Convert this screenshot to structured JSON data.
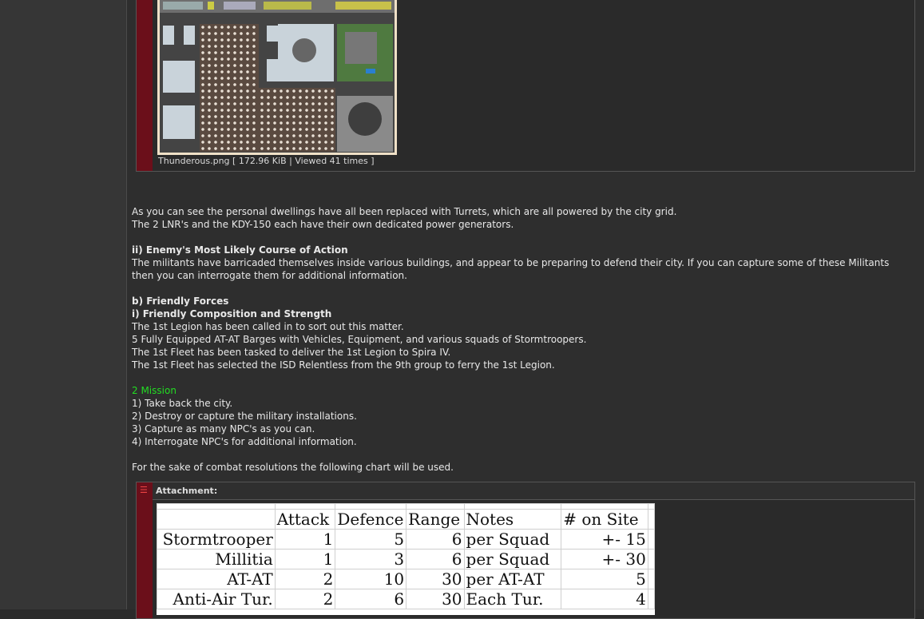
{
  "attachment_image": {
    "caption": "Thunderous.png [ 172.96 KiB | Viewed 41 times ]"
  },
  "body": {
    "p1_line1": "As you can see the personal dwellings have all been replaced with Turrets, which are all powered by the city grid.",
    "p1_line2": "The 2 LNR's and the KDY-150 each have their own dedicated power generators.",
    "h_enemy": "ii) Enemy's Most Likely Course of Action",
    "enemy_line1": "The militants have barricaded themselves inside various buildings, and appear to be preparing to defend their city. If you can capture some of these Militants",
    "enemy_line2": "then you can interrogate them for additional information.",
    "h_friendly": "b) Friendly Forces",
    "h_composition": "i) Friendly Composition and Strength",
    "friendly": [
      "The 1st Legion has been called in to sort out this matter.",
      "5 Fully Equipped AT-AT Barges with Vehicles, Equipment, and various squads of Stormtroopers.",
      "The 1st Fleet has been tasked to deliver the 1st Legion to Spira IV.",
      "The 1st Fleet has selected the ISD Relentless from the 9th group to ferry the 1st Legion."
    ],
    "h_mission": "2 Mission",
    "mission": [
      "1) Take back the city.",
      "2) Destroy or capture the military installations.",
      "3) Capture as many NPC's as you can.",
      "4) Interrogate NPC's for additional information."
    ],
    "chart_intro": "For the sake of combat resolutions the following chart will be used."
  },
  "attachment2": {
    "label": "Attachment:",
    "icon": "list-icon"
  },
  "table": {
    "headers": [
      "",
      "Attack",
      "Defence",
      "Range",
      "Notes",
      "# on Site"
    ],
    "rows": [
      [
        "Stormtrooper",
        "1",
        "5",
        "6",
        "per Squad",
        "+- 15"
      ],
      [
        "Millitia",
        "1",
        "3",
        "6",
        "per Squad",
        "+- 30"
      ],
      [
        "AT-AT",
        "2",
        "10",
        "30",
        "per AT-AT",
        "5"
      ],
      [
        "Anti-Air Tur.",
        "2",
        "6",
        "30",
        "Each Tur.",
        "4"
      ]
    ]
  },
  "colors": {
    "accent_bar": "#6b0f1a",
    "mission_heading": "#22dd22"
  }
}
